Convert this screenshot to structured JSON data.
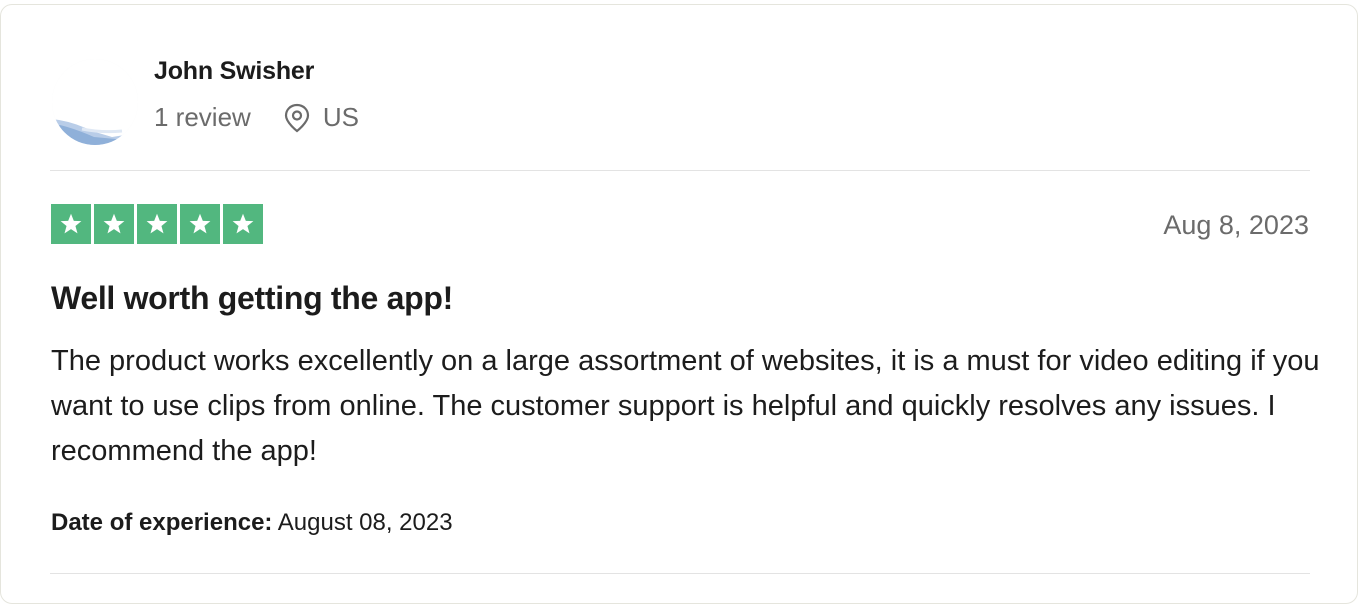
{
  "reviewer": {
    "name": "John Swisher",
    "review_count": "1 review",
    "location_icon": "location-pin-icon",
    "country": "US",
    "avatar": "avatar-photo"
  },
  "review": {
    "rating": 5,
    "rating_max": 5,
    "star_color": "#52b77f",
    "date": "Aug 8, 2023",
    "title": "Well worth getting the app!",
    "body": "The product works excellently on a large assortment of websites, it is a must for video editing if you want to use clips from online. The customer support is helpful and quickly resolves any issues. I recommend the app!",
    "experience_label": "Date of experience:",
    "experience_date": "August 08, 2023"
  }
}
